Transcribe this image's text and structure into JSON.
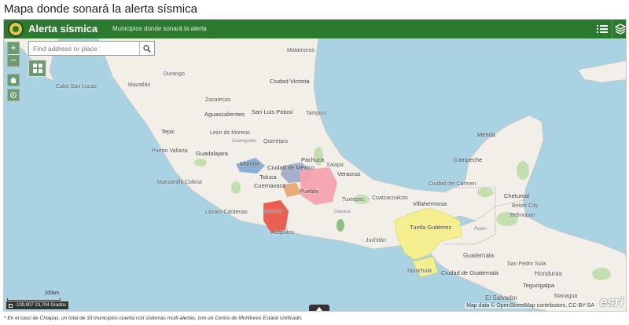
{
  "page": {
    "title": "Mapa donde sonará la alerta sísmica",
    "footnote": "* En el caso de Chiapas, un total de 33 municipios cuenta con sistemas multi-alertas, con un Centro de Monitoreo Estatal Unificado."
  },
  "header": {
    "title": "Alerta sísmica",
    "subtitle": "Municipios donde sonará la alerta",
    "logo_icon": "seal-logo",
    "background_color": "#2c7a2e",
    "buttons": [
      {
        "name": "list-icon"
      },
      {
        "name": "layers-icon"
      }
    ]
  },
  "controls": {
    "zoom_in": "+",
    "zoom_out": "−",
    "home_icon": "home-icon",
    "locate_icon": "locate-icon",
    "basemap_icon": "grid-icon"
  },
  "search": {
    "placeholder": "Find address or place",
    "button_icon": "search-icon"
  },
  "scale": {
    "label": "200km"
  },
  "coords": {
    "value": "-109,907 23,704 Grados"
  },
  "attribution": "Map data © OpenStreetMap contributors, CC-BY-SA",
  "esri_logo": "esri",
  "colors": {
    "water": "#a9d2e3",
    "land": "#f2efe9",
    "alert_orange": "#e8844c",
    "alert_pink": "#f4a3b0",
    "alert_red": "#e8574a",
    "alert_yellow": "#f7f08c",
    "alert_blue": "#7ea7d4"
  },
  "places": {
    "durango": "Durango",
    "mazatlan": "Mazatlán",
    "zacatecas": "Zacatecas",
    "cabo_san_lucas": "Cabo San Lucas",
    "ciudad_victoria": "Ciudad Victoria",
    "san_luis_potosi": "San Luis Potosí",
    "aguascalientes": "Aguascalientes",
    "leon": "León de Moreno",
    "guanajuato": "Guanajuato",
    "tepic": "Tepic",
    "puerto_vallarta": "Puerto Vallarta",
    "guadalajara": "Guadalajara",
    "queretaro": "Querétaro",
    "pachuca": "Pachuca",
    "morelia": "Morelia",
    "toluca": "Toluca",
    "ciudad_mexico": "Ciudad de México",
    "cuernavaca": "Cuernavaca",
    "colima": "Colima",
    "manzanillo": "Manzanillo",
    "veracruz": "Veracruz",
    "xalapa": "Xalapa",
    "puebla": "Puebla",
    "oaxaca": "Oaxaca",
    "tuxtepec": "Tuxtepec",
    "lazaro_cardenas": "Lázaro Cárdenas",
    "guerrero": "Guerrero",
    "acapulco": "Acapulco",
    "juchitan": "Juchitán",
    "coatzacoalcos": "Coatzacoalcos",
    "villahermosa": "Villahermosa",
    "tuxtla": "Tuxtla Gutiérrez",
    "tapachula": "Tapachula",
    "campeche": "Campeche",
    "ciudad_carmen": "Ciudad del Carmen",
    "merida": "Mérida",
    "chetumal": "Chetumal",
    "belize": "Belize City",
    "belmopan": "Belmopan",
    "guatemala": "Guatemala",
    "ciudad_guatemala": "Ciudad de Guatemala",
    "san_pedro_sula": "San Pedro Sula",
    "honduras": "Honduras",
    "tegucigalpa": "Tegucigalpa",
    "el_salvador": "El Salvador",
    "peten": "Petén",
    "managua": "Managua",
    "tampico": "Tampico",
    "matamoros": "Matamoros"
  }
}
